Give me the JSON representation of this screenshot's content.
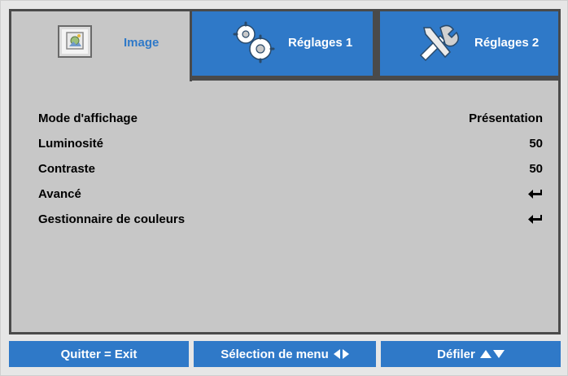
{
  "tabs": [
    {
      "label": "Image",
      "icon": "image-settings-icon",
      "active": true
    },
    {
      "label": "Réglages 1",
      "icon": "gears-icon",
      "active": false
    },
    {
      "label": "Réglages 2",
      "icon": "tools-icon",
      "active": false
    }
  ],
  "menu": [
    {
      "label": "Mode d'affichage",
      "value": "Présentation"
    },
    {
      "label": "Luminosité",
      "value": "50"
    },
    {
      "label": "Contraste",
      "value": "50"
    },
    {
      "label": "Avancé",
      "value": "",
      "icon": "enter-icon"
    },
    {
      "label": "Gestionnaire de couleurs",
      "value": "",
      "icon": "enter-icon"
    }
  ],
  "footer": {
    "exit": "Quitter = Exit",
    "select": "Sélection de menu",
    "scroll": "Défiler"
  },
  "colors": {
    "accent": "#2f79c8",
    "panel": "#c7c7c7",
    "border": "#4a4a4a"
  }
}
